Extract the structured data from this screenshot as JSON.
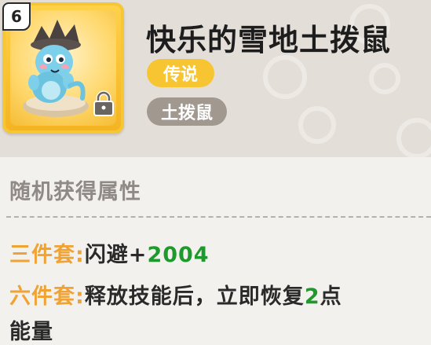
{
  "item": {
    "level": "6",
    "name": "快乐的雪地土拨鼠",
    "rarity_tag": "传说",
    "type_tag": "土拨鼠",
    "locked": true
  },
  "attributes": {
    "section_title": "随机获得属性",
    "set3": {
      "label": "三件套",
      "colon": ":",
      "stat": "闪避+",
      "value": "2004"
    },
    "set6": {
      "label": "六件套",
      "colon": ":",
      "text_before": "释放技能后，立即恢复",
      "value": "2",
      "text_after": "点",
      "line2": "能量"
    }
  },
  "colors": {
    "legend": "#f7c531",
    "type": "#a19990",
    "set_label": "#f0a233",
    "value": "#1e9a2c",
    "card_gold": "#f5b321"
  },
  "icons": [
    "groundhog-pet-icon",
    "lock-icon"
  ]
}
